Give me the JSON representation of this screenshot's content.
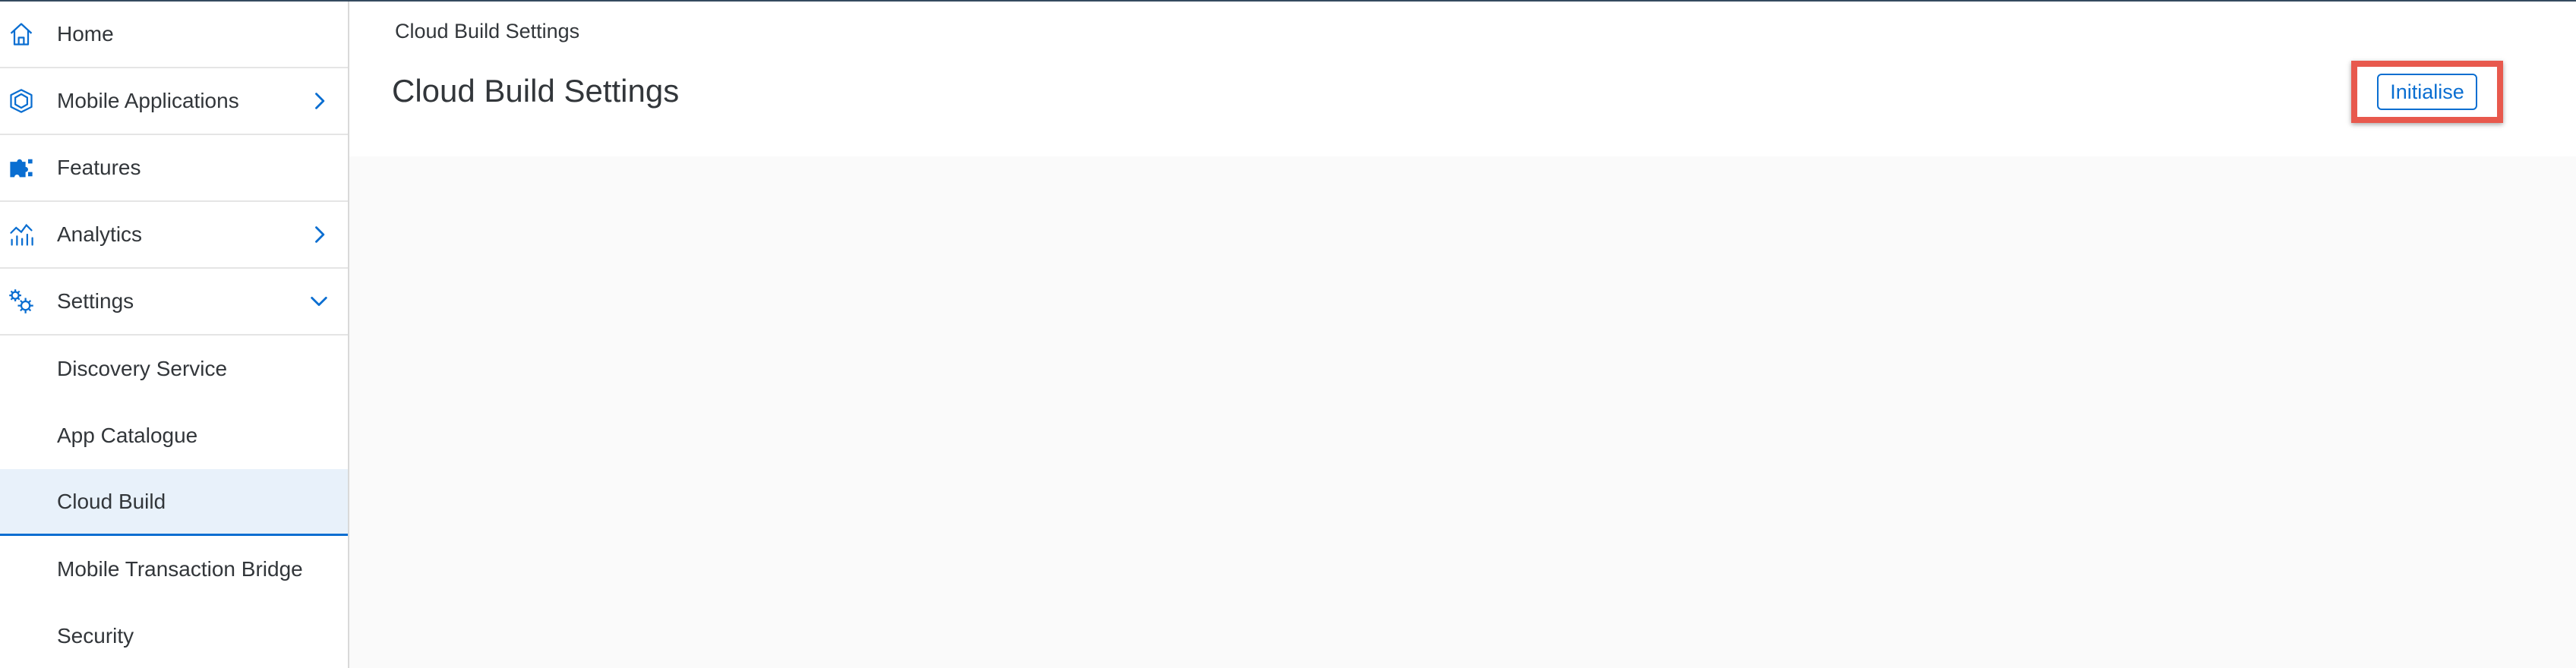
{
  "sidebar": {
    "items": [
      {
        "label": "Home",
        "icon": "home-icon",
        "chevron": "none"
      },
      {
        "label": "Mobile Applications",
        "icon": "cube-icon",
        "chevron": "right"
      },
      {
        "label": "Features",
        "icon": "puzzle-icon",
        "chevron": "none"
      },
      {
        "label": "Analytics",
        "icon": "analytics-icon",
        "chevron": "right"
      },
      {
        "label": "Settings",
        "icon": "gears-icon",
        "chevron": "down"
      },
      {
        "label": "Discovery Service",
        "sub": true
      },
      {
        "label": "App Catalogue",
        "sub": true
      },
      {
        "label": "Cloud Build",
        "sub": true,
        "selected": true
      },
      {
        "label": "Mobile Transaction Bridge",
        "sub": true
      },
      {
        "label": "Security",
        "sub": true
      }
    ]
  },
  "header": {
    "breadcrumb": "Cloud Build Settings",
    "title": "Cloud Build Settings",
    "initialise_label": "Initialise"
  },
  "colors": {
    "accent": "#0a6ed1",
    "selected_bg": "#e8f1fa",
    "highlight": "#e8594d",
    "content_bg": "#fafafa"
  }
}
